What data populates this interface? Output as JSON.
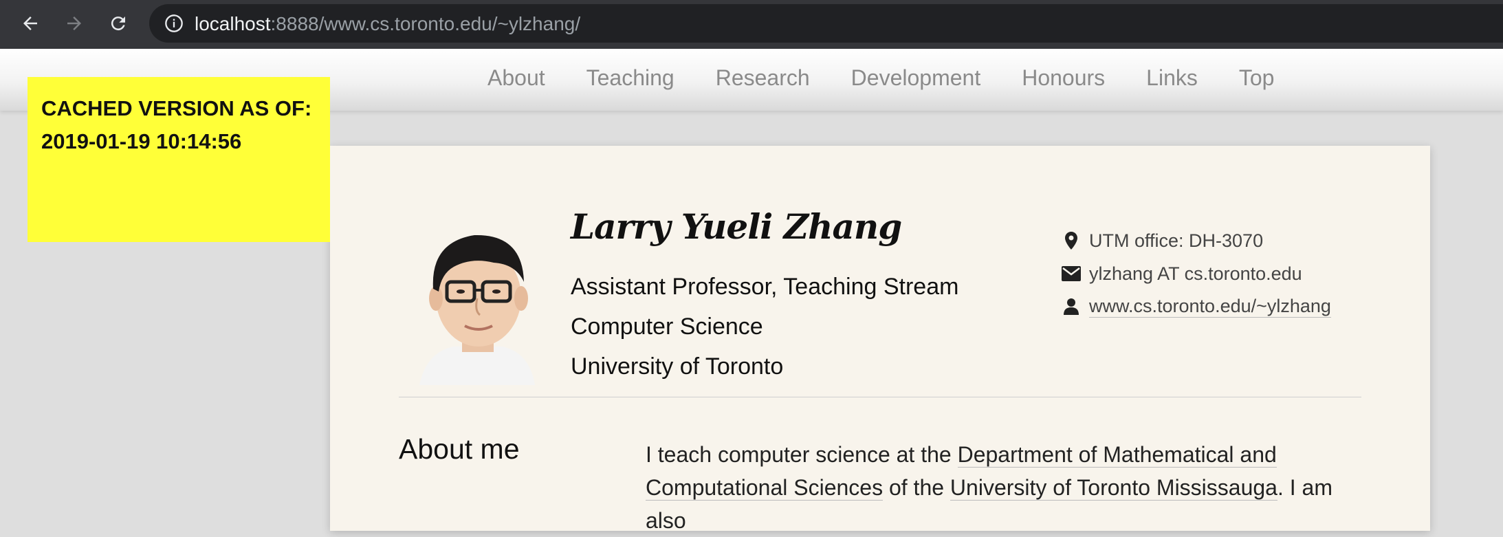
{
  "browser": {
    "url_host": "localhost",
    "url_rest": ":8888/www.cs.toronto.edu/~ylzhang/",
    "icons": [
      "back-arrow-icon",
      "forward-arrow-icon",
      "reload-icon",
      "info-icon"
    ]
  },
  "nav": {
    "items": [
      "About",
      "Teaching",
      "Research",
      "Development",
      "Honours",
      "Links",
      "Top"
    ]
  },
  "cached": {
    "line1": "CACHED VERSION AS OF:",
    "line2": "2019-01-19 10:14:56"
  },
  "profile": {
    "name": "Larry Yueli Zhang",
    "titles": [
      "Assistant Professor, Teaching Stream",
      "Computer Science",
      "University of Toronto"
    ],
    "contact": {
      "office": "UTM office: DH-3070",
      "email": "ylzhang AT cs.toronto.edu",
      "website": "www.cs.toronto.edu/~ylzhang"
    }
  },
  "about": {
    "heading": "About me",
    "text_1": "I teach computer science at the ",
    "link_1": "Department of Mathematical and Computational Sciences",
    "text_2": " of the ",
    "link_2": "University of Toronto Mississauga",
    "text_3": ". I am also"
  },
  "colors": {
    "chrome": "#35363a",
    "omnibox": "#202124",
    "cached_bg": "#ffff38",
    "card_bg": "#f8f4ec",
    "page_bg": "#dedede"
  }
}
